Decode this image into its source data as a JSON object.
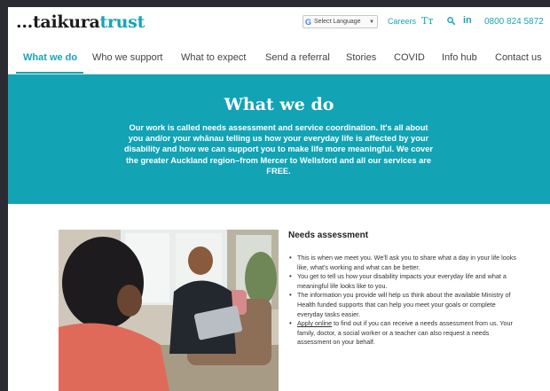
{
  "header": {
    "logo_prefix": "...",
    "logo_main": "taikura",
    "logo_accent": "trust",
    "language_selector": "Select Language",
    "careers": "Careers",
    "text_size_icon": "Tт",
    "search_icon": "search-icon",
    "linkedin_icon": "in",
    "phone": "0800 824 5872"
  },
  "nav": {
    "items": [
      {
        "label": "What we do"
      },
      {
        "label": "Who we support"
      },
      {
        "label": "What to expect"
      },
      {
        "label": "Send a referral"
      },
      {
        "label": "Stories"
      },
      {
        "label": "COVID"
      },
      {
        "label": "Info hub"
      },
      {
        "label": "Contact us"
      }
    ],
    "active": "What we do"
  },
  "hero": {
    "title": "What we do",
    "body": "Our work is called needs assessment and service coordination. It's all about you and/or your whānau telling us how your everyday life is affected by your disability and how we can support you to make life more meaningful. We cover the greater Auckland region–from Mercer to Wellsford and all our services are FREE."
  },
  "needs_assessment": {
    "title": "Needs assessment",
    "bullets": [
      {
        "text": "This is when we meet you. We'll ask you to share what a day in your life looks like, what's working and what can be better."
      },
      {
        "text": "You get to tell us how your disability impacts your everyday life and what a meaningful life looks like to you."
      },
      {
        "text": "The information you provide will help us think about the available Ministry of Health funded supports that can help you meet your goals or complete everyday tasks easier."
      },
      {
        "link": "Apply online",
        "text": " to find out if you can receive a needs assessment from us. Your family, doctor, a social worker or a teacher can also request a needs assessment on your behalf."
      }
    ]
  },
  "colors": {
    "brand_teal": "#12a3b5",
    "accent_text": "#18a4b7"
  }
}
